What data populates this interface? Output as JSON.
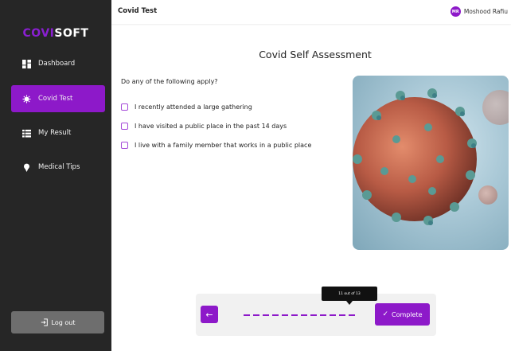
{
  "brand": {
    "part1": "COVI",
    "part2": "SOFT"
  },
  "sidebar": {
    "items": [
      {
        "label": "Dashboard",
        "icon": "dashboard-icon",
        "active": false
      },
      {
        "label": "Covid Test",
        "icon": "virus-icon",
        "active": true
      },
      {
        "label": "My Result",
        "icon": "list-icon",
        "active": false
      },
      {
        "label": "Medical Tips",
        "icon": "pin-icon",
        "active": false
      }
    ],
    "logout_label": "Log out"
  },
  "header": {
    "title": "Covid Test",
    "user_initials": "MR",
    "user_name": "Moshood Rafiu"
  },
  "main": {
    "title": "Covid Self Assessment",
    "question": "Do any of the following apply?",
    "options": [
      "I recently attended a large gathering",
      "I have visited a public place in the past 14 days",
      "I live with a family member that works in a public place"
    ]
  },
  "footer": {
    "tooltip": "11 out of 13",
    "back_label": "←",
    "complete_label": "Complete",
    "progress_current": 11,
    "progress_total": 13
  },
  "colors": {
    "accent": "#8d19c9",
    "sidebar_bg": "#262626"
  }
}
